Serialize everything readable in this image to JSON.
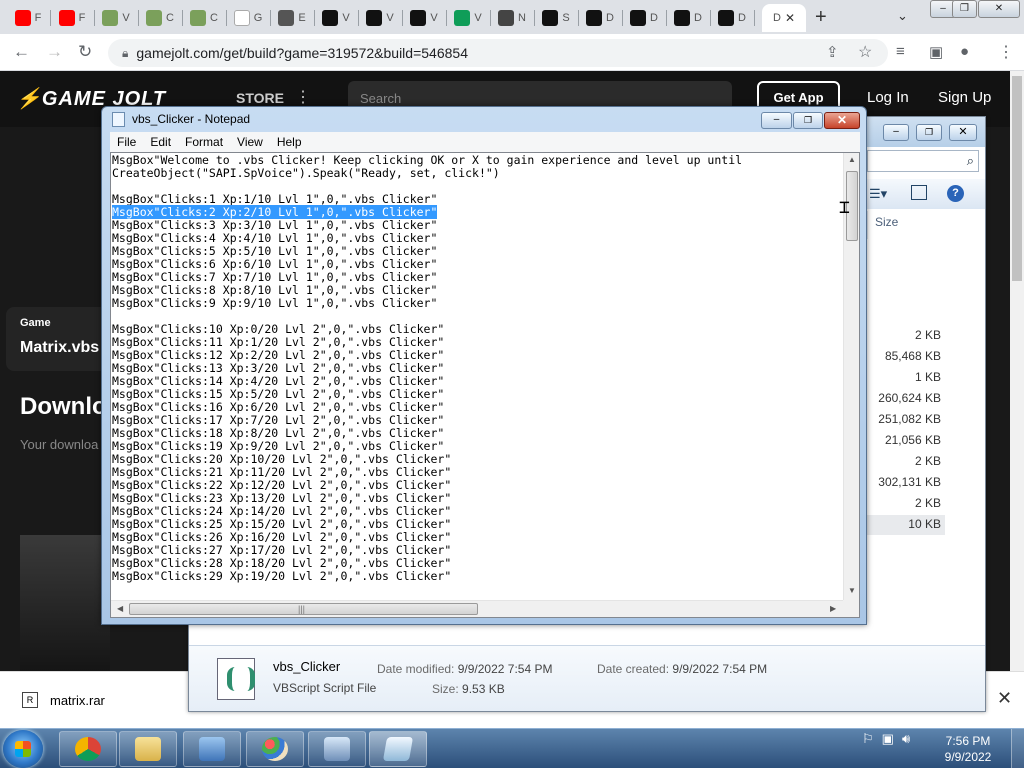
{
  "browser": {
    "tabs": [
      {
        "label": "F",
        "fav": "youtube-icon"
      },
      {
        "label": "F",
        "fav": "youtube-icon"
      },
      {
        "label": "V",
        "fav": "image-icon"
      },
      {
        "label": "C",
        "fav": "image-icon"
      },
      {
        "label": "C",
        "fav": "image-icon"
      },
      {
        "label": "G",
        "fav": "google-icon"
      },
      {
        "label": "E",
        "fav": "globe-icon"
      },
      {
        "label": "V",
        "fav": "w-icon"
      },
      {
        "label": "V",
        "fav": "w-icon"
      },
      {
        "label": "V",
        "fav": "w-icon"
      },
      {
        "label": "V",
        "fav": "sheet-icon"
      },
      {
        "label": "N",
        "fav": "bank-icon"
      },
      {
        "label": "S",
        "fav": "n-icon"
      },
      {
        "label": "D",
        "fav": "n-icon"
      },
      {
        "label": "D",
        "fav": "n-icon"
      },
      {
        "label": "D",
        "fav": "n-icon"
      },
      {
        "label": "D",
        "fav": "n-icon"
      }
    ],
    "active_tab": "D",
    "new_tab": "+",
    "url": "gamejolt.com/get/build?game=319572&build=546854",
    "colors": {
      "tabbar": "#dee1e6",
      "youtube": "#ff0000"
    }
  },
  "gamejolt": {
    "logo": "GAME JOLT",
    "store": "STORE",
    "get_app": "Get App",
    "login": "Log In",
    "signup": "Sign Up",
    "search_placeholder": "Search",
    "card_label": "Game",
    "card_title": "Matrix.vbs",
    "download_heading": "Downlo",
    "download_subtext": "Your downloa"
  },
  "downloads_bar": {
    "filename": "matrix.rar",
    "close": "✕"
  },
  "explorer": {
    "size_header": "Size",
    "sizes": [
      "2 KB",
      "85,468 KB",
      "1 KB",
      "260,624 KB",
      "251,082 KB",
      "21,056 KB",
      "2 KB",
      "302,131 KB",
      "2 KB",
      "10 KB"
    ],
    "details": {
      "name": "vbs_Clicker",
      "type": "VBScript Script File",
      "modified_label": "Date modified:",
      "modified_value": "9/9/2022 7:54 PM",
      "created_label": "Date created:",
      "created_value": "9/9/2022 7:54 PM",
      "size_label": "Size:",
      "size_value": "9.53 KB"
    }
  },
  "notepad": {
    "title": "vbs_Clicker - Notepad",
    "menu": [
      "File",
      "Edit",
      "Format",
      "View",
      "Help"
    ],
    "selected_line_index": 4,
    "lines": [
      "MsgBox\"Welcome to .vbs Clicker! Keep clicking OK or X to gain experience and level up until",
      "CreateObject(\"SAPI.SpVoice\").Speak(\"Ready, set, click!\")",
      "",
      "MsgBox\"Clicks:1 Xp:1/10 Lvl 1\",0,\".vbs Clicker\"",
      "MsgBox\"Clicks:2 Xp:2/10 Lvl 1\",0,\".vbs Clicker\"",
      "MsgBox\"Clicks:3 Xp:3/10 Lvl 1\",0,\".vbs Clicker\"",
      "MsgBox\"Clicks:4 Xp:4/10 Lvl 1\",0,\".vbs Clicker\"",
      "MsgBox\"Clicks:5 Xp:5/10 Lvl 1\",0,\".vbs Clicker\"",
      "MsgBox\"Clicks:6 Xp:6/10 Lvl 1\",0,\".vbs Clicker\"",
      "MsgBox\"Clicks:7 Xp:7/10 Lvl 1\",0,\".vbs Clicker\"",
      "MsgBox\"Clicks:8 Xp:8/10 Lvl 1\",0,\".vbs Clicker\"",
      "MsgBox\"Clicks:9 Xp:9/10 Lvl 1\",0,\".vbs Clicker\"",
      "",
      "MsgBox\"Clicks:10 Xp:0/20 Lvl 2\",0,\".vbs Clicker\"",
      "MsgBox\"Clicks:11 Xp:1/20 Lvl 2\",0,\".vbs Clicker\"",
      "MsgBox\"Clicks:12 Xp:2/20 Lvl 2\",0,\".vbs Clicker\"",
      "MsgBox\"Clicks:13 Xp:3/20 Lvl 2\",0,\".vbs Clicker\"",
      "MsgBox\"Clicks:14 Xp:4/20 Lvl 2\",0,\".vbs Clicker\"",
      "MsgBox\"Clicks:15 Xp:5/20 Lvl 2\",0,\".vbs Clicker\"",
      "MsgBox\"Clicks:16 Xp:6/20 Lvl 2\",0,\".vbs Clicker\"",
      "MsgBox\"Clicks:17 Xp:7/20 Lvl 2\",0,\".vbs Clicker\"",
      "MsgBox\"Clicks:18 Xp:8/20 Lvl 2\",0,\".vbs Clicker\"",
      "MsgBox\"Clicks:19 Xp:9/20 Lvl 2\",0,\".vbs Clicker\"",
      "MsgBox\"Clicks:20 Xp:10/20 Lvl 2\",0,\".vbs Clicker\"",
      "MsgBox\"Clicks:21 Xp:11/20 Lvl 2\",0,\".vbs Clicker\"",
      "MsgBox\"Clicks:22 Xp:12/20 Lvl 2\",0,\".vbs Clicker\"",
      "MsgBox\"Clicks:23 Xp:13/20 Lvl 2\",0,\".vbs Clicker\"",
      "MsgBox\"Clicks:24 Xp:14/20 Lvl 2\",0,\".vbs Clicker\"",
      "MsgBox\"Clicks:25 Xp:15/20 Lvl 2\",0,\".vbs Clicker\"",
      "MsgBox\"Clicks:26 Xp:16/20 Lvl 2\",0,\".vbs Clicker\"",
      "MsgBox\"Clicks:27 Xp:17/20 Lvl 2\",0,\".vbs Clicker\"",
      "MsgBox\"Clicks:28 Xp:18/20 Lvl 2\",0,\".vbs Clicker\"",
      "MsgBox\"Clicks:29 Xp:19/20 Lvl 2\",0,\".vbs Clicker\""
    ]
  },
  "taskbar": {
    "items": [
      "chrome-icon",
      "explorer-icon",
      "control-panel-icon",
      "paint-icon",
      "network-icon",
      "notepad-icon"
    ],
    "time": "7:56 PM",
    "date": "9/9/2022",
    "colors": {
      "bar": "#2c4f7a"
    }
  }
}
